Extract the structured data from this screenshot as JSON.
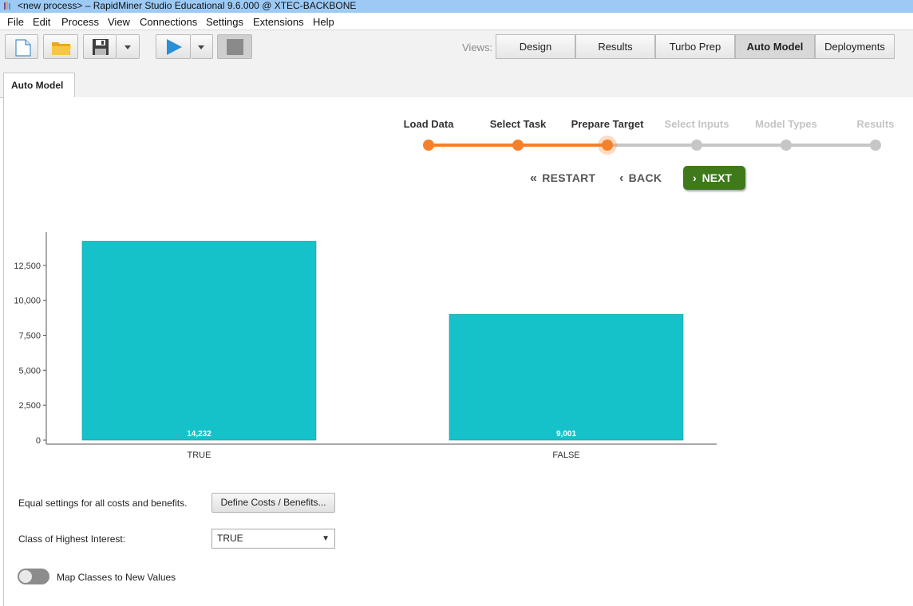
{
  "window": {
    "title": "<new process> – RapidMiner Studio Educational 9.6.000 @ XTEC-BACKBONE"
  },
  "menu": [
    "File",
    "Edit",
    "Process",
    "View",
    "Connections",
    "Settings",
    "Extensions",
    "Help"
  ],
  "toolbar": {
    "views_label": "Views:",
    "views": [
      "Design",
      "Results",
      "Turbo Prep",
      "Auto Model",
      "Deployments"
    ],
    "active_view": "Auto Model",
    "icons": [
      "new-process-icon",
      "open-folder-icon",
      "save-icon",
      "dropdown-arrow-icon",
      "run-icon",
      "dropdown-arrow-icon",
      "stop-icon"
    ]
  },
  "panel_tab": "Auto Model",
  "stepper": {
    "steps": [
      "Load Data",
      "Select Task",
      "Prepare Target",
      "Select Inputs",
      "Model Types",
      "Results"
    ],
    "current_index": 2,
    "active_color": "#f6802a",
    "inactive_color": "#c6c6c6"
  },
  "nav": {
    "restart": "RESTART",
    "back": "BACK",
    "next": "NEXT",
    "next_color": "#3e7a1c"
  },
  "chart_data": {
    "type": "bar",
    "categories": [
      "TRUE",
      "FALSE"
    ],
    "values": [
      14232,
      9001
    ],
    "value_labels": [
      "14,232",
      "9,001"
    ],
    "yticks": [
      "0",
      "2,500",
      "5,000",
      "7,500",
      "10,000",
      "12,500"
    ],
    "ytick_values": [
      0,
      2500,
      5000,
      7500,
      10000,
      12500
    ],
    "ylim": [
      0,
      15000
    ],
    "bar_color": "#16c2c9",
    "title": "",
    "xlabel": "",
    "ylabel": "",
    "grid": false,
    "legend": "none"
  },
  "settings": {
    "costs_label": "Equal settings for all costs and benefits.",
    "costs_button": "Define Costs / Benefits...",
    "class_label": "Class of Highest Interest:",
    "class_value": "TRUE",
    "map_toggle_label": "Map Classes to New Values",
    "map_toggle_on": false
  }
}
